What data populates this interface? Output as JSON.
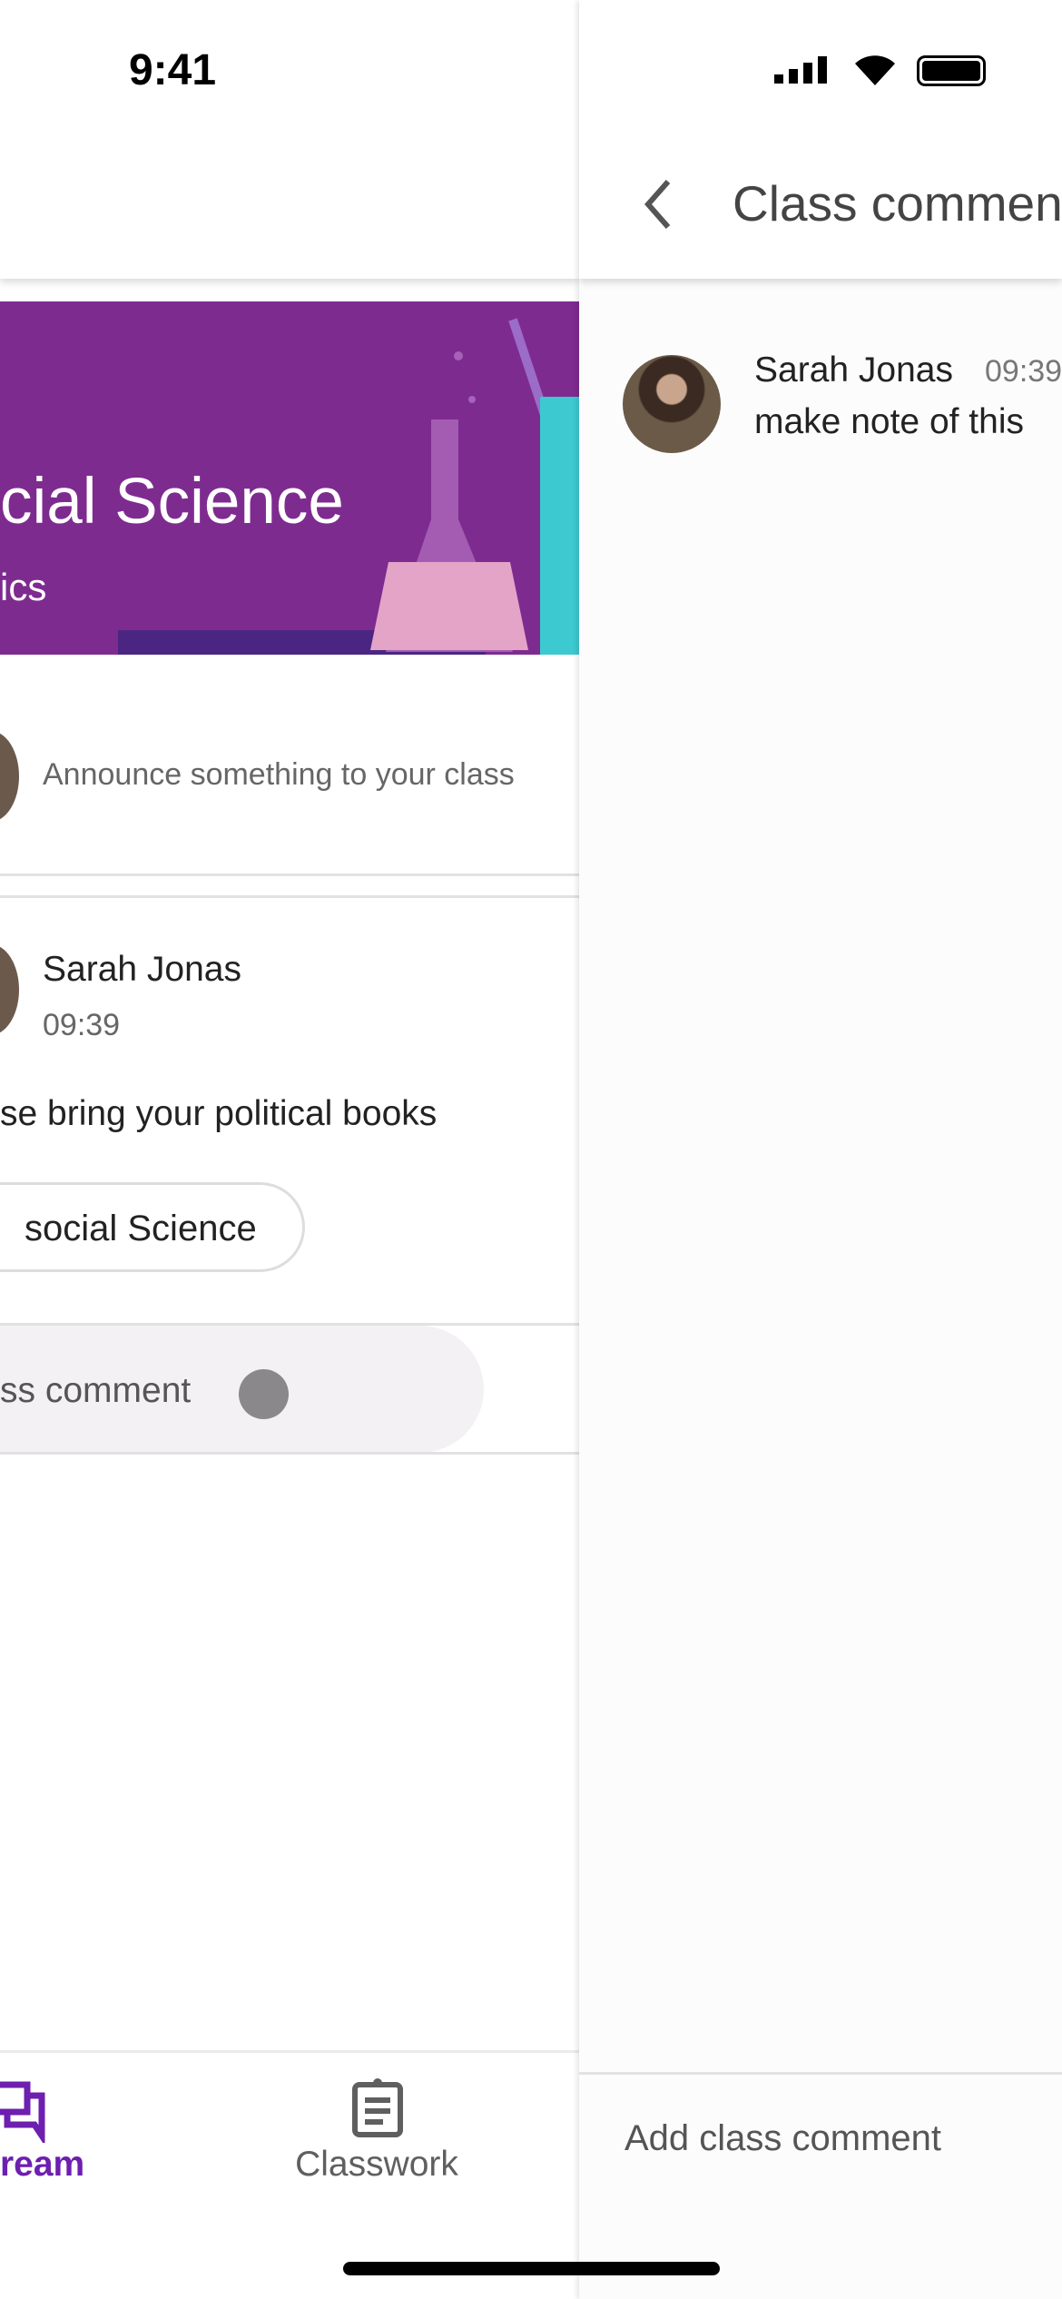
{
  "status": {
    "time": "9:41"
  },
  "stream": {
    "banner": {
      "title": "cial Science",
      "subtitle": "ics",
      "colors": {
        "bg": "#7e2b90",
        "bar": "#4a2682",
        "flask": "#e79aa8",
        "beaker": "#3cc9d0"
      }
    },
    "announce_placeholder": "Announce something to your class",
    "post": {
      "author": "Sarah Jonas",
      "time": "09:39",
      "body": "se bring your political books",
      "chip": "social Science",
      "comment_link": "ss comment"
    },
    "nav": {
      "items": [
        {
          "label": "ream",
          "icon": "stream-icon",
          "active": true
        },
        {
          "label": "Classwork",
          "icon": "classwork-icon",
          "active": false
        }
      ],
      "accent": "#6d1fb0"
    }
  },
  "comments": {
    "title": "Class comment",
    "items": [
      {
        "author": "Sarah Jonas",
        "time": "09:39",
        "text": "make note of this"
      }
    ],
    "input_placeholder": "Add class comment"
  }
}
